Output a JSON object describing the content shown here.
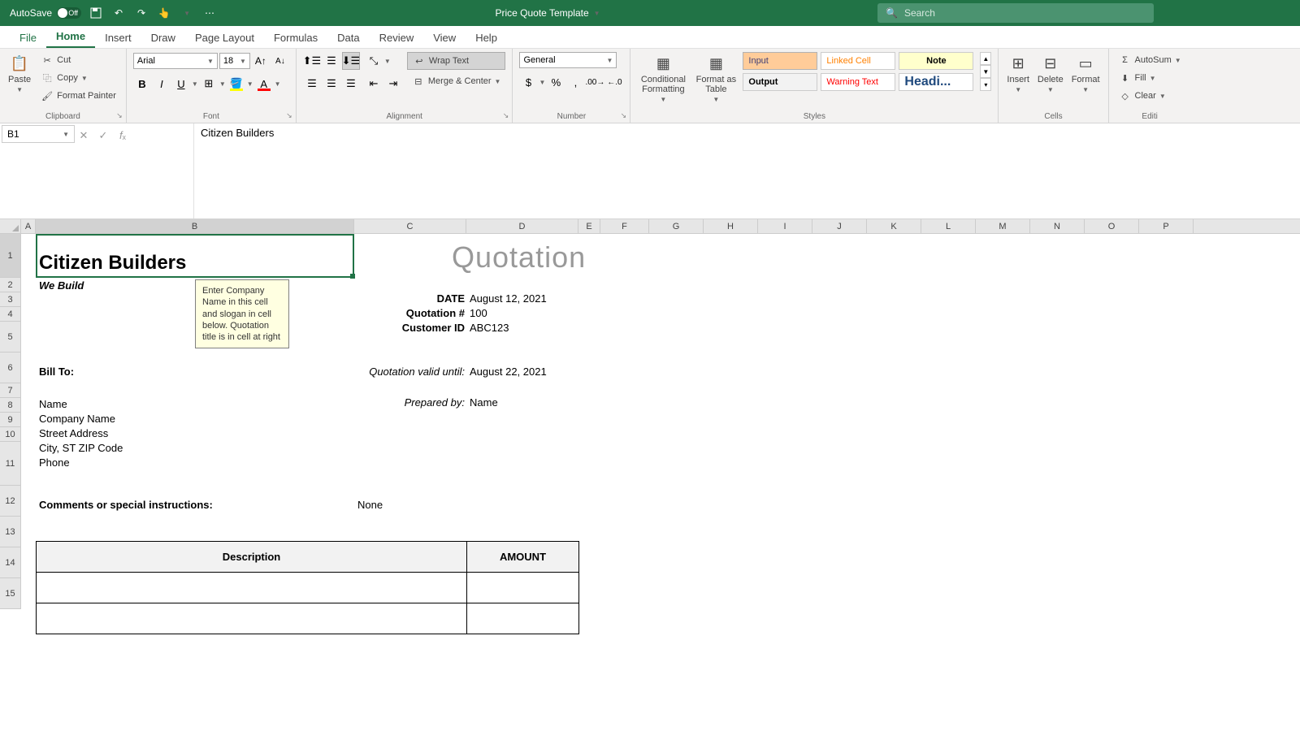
{
  "titlebar": {
    "autosave_label": "AutoSave",
    "autosave_state": "Off",
    "doc_title": "Price Quote Template",
    "search_placeholder": "Search"
  },
  "tabs": {
    "file": "File",
    "home": "Home",
    "insert": "Insert",
    "draw": "Draw",
    "page_layout": "Page Layout",
    "formulas": "Formulas",
    "data": "Data",
    "review": "Review",
    "view": "View",
    "help": "Help"
  },
  "ribbon": {
    "clipboard": {
      "label": "Clipboard",
      "paste": "Paste",
      "cut": "Cut",
      "copy": "Copy",
      "painter": "Format Painter"
    },
    "font": {
      "label": "Font",
      "name": "Arial",
      "size": "18"
    },
    "alignment": {
      "label": "Alignment",
      "wrap": "Wrap Text",
      "merge": "Merge & Center"
    },
    "number": {
      "label": "Number",
      "format": "General"
    },
    "styles": {
      "label": "Styles",
      "cond": "Conditional Formatting",
      "table": "Format as Table",
      "input": "Input",
      "linked": "Linked Cell",
      "note": "Note",
      "output": "Output",
      "warning": "Warning Text",
      "heading": "Headi..."
    },
    "cells": {
      "label": "Cells",
      "insert": "Insert",
      "delete": "Delete",
      "format": "Format"
    },
    "editing": {
      "label": "Editi",
      "autosum": "AutoSum",
      "fill": "Fill",
      "clear": "Clear"
    }
  },
  "formulabar": {
    "namebox": "B1",
    "formula": "Citizen Builders"
  },
  "sheet": {
    "cols": [
      "A",
      "B",
      "C",
      "D",
      "E",
      "F",
      "G",
      "H",
      "I",
      "J",
      "K",
      "L",
      "M",
      "N",
      "O",
      "P"
    ],
    "rows": [
      "1",
      "2",
      "3",
      "4",
      "5",
      "6",
      "7",
      "8",
      "9",
      "10",
      "11",
      "12",
      "13",
      "14",
      "15"
    ],
    "company": "Citizen Builders",
    "slogan": "We Build",
    "quotation": "Quotation",
    "date_lbl": "DATE",
    "date_val": "August 12, 2021",
    "quote_no_lbl": "Quotation #",
    "quote_no_val": "100",
    "cust_id_lbl": "Customer ID",
    "cust_id_val": "ABC123",
    "billto": "Bill To:",
    "valid_lbl": "Quotation valid until:",
    "valid_val": "August 22, 2021",
    "prep_lbl": "Prepared by:",
    "prep_val": "Name",
    "name": "Name",
    "company_name": "Company Name",
    "street": "Street Address",
    "city": "City, ST  ZIP Code",
    "phone": "Phone",
    "comments_lbl": "Comments or special instructions:",
    "comments_val": "None",
    "desc_hdr": "Description",
    "amt_hdr": "AMOUNT",
    "tooltip": "Enter Company Name in this cell and slogan in cell below. Quotation title is in cell at right"
  }
}
